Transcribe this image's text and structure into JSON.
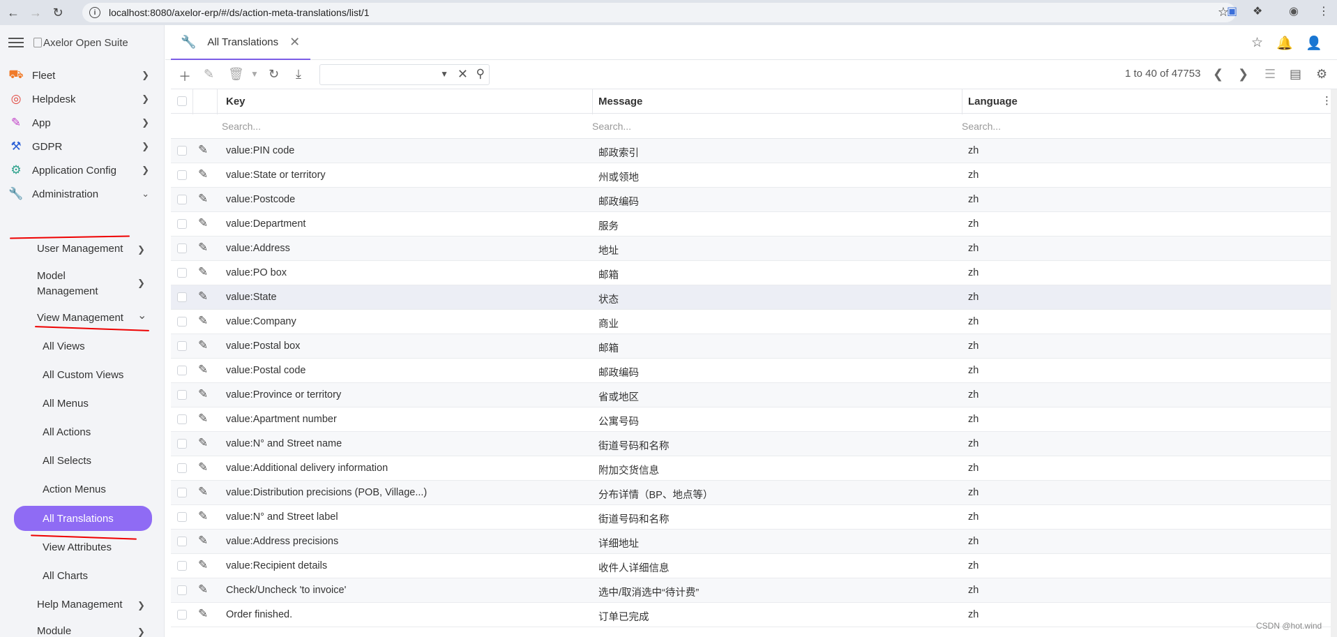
{
  "browser": {
    "url": "localhost:8080/axelor-erp/#/ds/action-meta-translations/list/1"
  },
  "sidebar": {
    "logo_alt": "Axelor Open Suite",
    "items": [
      {
        "label": "Fleet",
        "icon": "car-icon",
        "color": "#f07b2a"
      },
      {
        "label": "Helpdesk",
        "icon": "lifebuoy-icon",
        "color": "#e0453c"
      },
      {
        "label": "App",
        "icon": "edit-icon",
        "color": "#c13fc7"
      },
      {
        "label": "GDPR",
        "icon": "hammer-icon",
        "color": "#2a5fd6"
      },
      {
        "label": "Application Config",
        "icon": "gear-icon",
        "color": "#2aa08a"
      },
      {
        "label": "Administration",
        "icon": "wrench-icon",
        "color": "#2e9d3a"
      }
    ],
    "admin_sub": {
      "user_management": "User Management",
      "model_management_1": "Model",
      "model_management_2": "Management",
      "view_management": "View Management",
      "help_management": "Help Management",
      "module": "Module"
    },
    "view_management_items": [
      "All Views",
      "All Custom Views",
      "All Menus",
      "All Actions",
      "All Selects",
      "Action Menus",
      "All Translations",
      "View Attributes",
      "All Charts"
    ],
    "active_color": "#8f6bf4"
  },
  "tab": {
    "label": "All Translations"
  },
  "toolbar": {
    "pager_text": "1 to 40 of 47753"
  },
  "grid": {
    "columns": [
      "Key",
      "Message",
      "Language"
    ],
    "filter_placeholder": "Search...",
    "rows": [
      [
        "value:PIN code",
        "邮政索引",
        "zh"
      ],
      [
        "value:State or territory",
        "州或领地",
        "zh"
      ],
      [
        "value:Postcode",
        "邮政编码",
        "zh"
      ],
      [
        "value:Department",
        "服务",
        "zh"
      ],
      [
        "value:Address",
        "地址",
        "zh"
      ],
      [
        "value:PO box",
        "邮箱",
        "zh"
      ],
      [
        "value:State",
        "状态",
        "zh"
      ],
      [
        "value:Company",
        "商业",
        "zh"
      ],
      [
        "value:Postal box",
        "邮箱",
        "zh"
      ],
      [
        "value:Postal code",
        "邮政编码",
        "zh"
      ],
      [
        "value:Province or territory",
        "省或地区",
        "zh"
      ],
      [
        "value:Apartment number",
        "公寓号码",
        "zh"
      ],
      [
        "value:N° and Street name",
        "街道号码和名称",
        "zh"
      ],
      [
        "value:Additional delivery information",
        "附加交货信息",
        "zh"
      ],
      [
        "value:Distribution precisions (POB, Village...)",
        "分布详情（BP、地点等）",
        "zh"
      ],
      [
        "value:N° and Street label",
        "街道号码和名称",
        "zh"
      ],
      [
        "value:Address precisions",
        "详细地址",
        "zh"
      ],
      [
        "value:Recipient details",
        "收件人详细信息",
        "zh"
      ],
      [
        "Check/Uncheck 'to invoice'",
        "选中/取消选中“待计费”",
        "zh"
      ],
      [
        "Order finished.",
        "订单已完成",
        "zh"
      ]
    ],
    "highlighted_row_index": 6
  },
  "watermark": "CSDN @hot.wind"
}
